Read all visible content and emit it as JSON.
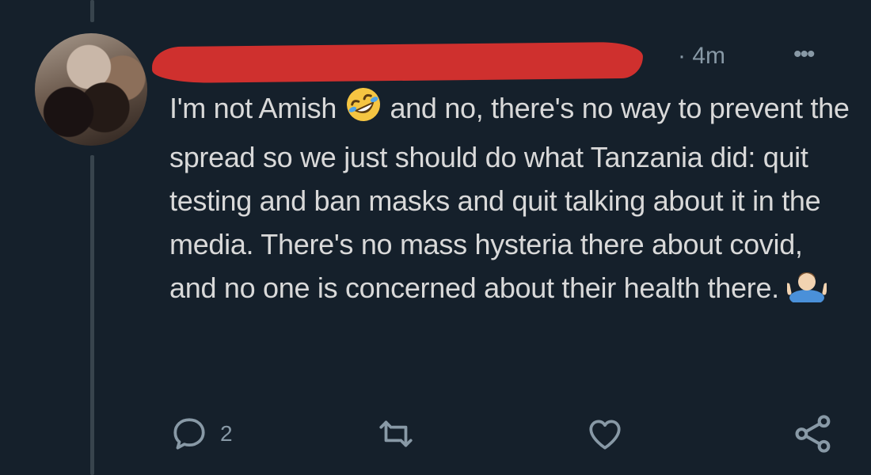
{
  "tweet": {
    "time": "4m",
    "more_icon": "ellipsis-icon",
    "text_parts": [
      "I'm not Amish ",
      " and no, there's no way to prevent the spread so we just should do what Tanzania did: quit testing and ban masks and quit talking about it in the media. There's no mass hysteria there about covid, and no one is concerned about their health there. "
    ],
    "emojis": [
      "rolling-on-floor-laughing-emoji",
      "man-shrugging-emoji"
    ]
  },
  "actions": {
    "reply_count": "2",
    "icons": [
      "reply-icon",
      "retweet-icon",
      "like-icon",
      "share-icon"
    ]
  },
  "colors": {
    "background": "#15202b",
    "text": "#d9d9d9",
    "muted": "#8899a6",
    "redaction": "#d9322e"
  }
}
